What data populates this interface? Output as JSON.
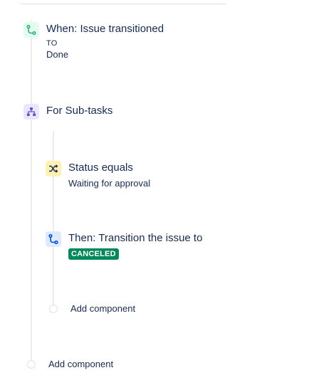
{
  "trigger": {
    "icon": "branch-transition-icon",
    "title": "When: Issue transitioned",
    "to_label": "TO",
    "to_value": "Done",
    "color": "#36b37e"
  },
  "branch": {
    "icon": "hierarchy-icon",
    "title": "For Sub-tasks",
    "color": "#6554c0"
  },
  "condition": {
    "icon": "shuffle-icon",
    "title": "Status equals",
    "value": "Waiting for approval",
    "color": "#ff991f"
  },
  "action": {
    "icon": "branch-transition-icon",
    "title": "Then: Transition the issue to",
    "status": "CANCELED",
    "status_color": "#00875a",
    "color": "#0052cc"
  },
  "nested_add": {
    "label": "Add component"
  },
  "root_add": {
    "label": "Add component"
  }
}
